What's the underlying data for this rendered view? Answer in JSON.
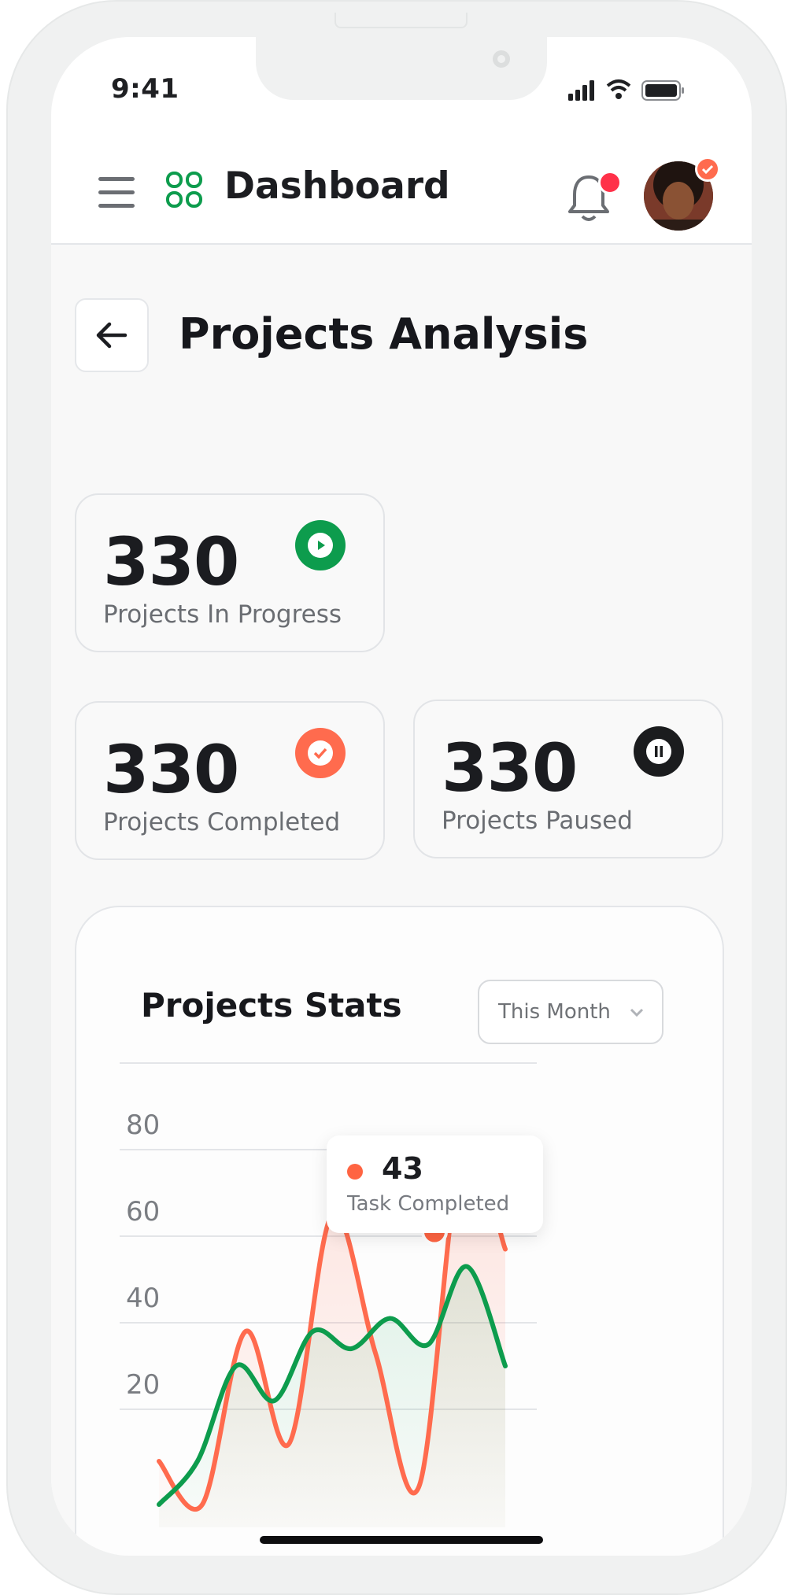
{
  "status_bar": {
    "time": "9:41"
  },
  "header": {
    "title": "Dashboard",
    "logo_icon": "apps-grid-icon",
    "menu_icon": "hamburger-icon",
    "notification_icon": "bell-icon"
  },
  "page": {
    "title": "Projects Analysis"
  },
  "stats": [
    {
      "value": "330",
      "label": "Projects In Progress",
      "icon": "play-icon",
      "color": "#0d9c4d"
    },
    {
      "value": "330",
      "label": "Projects Completed",
      "icon": "check-icon",
      "color": "#ff6b4e"
    },
    {
      "value": "330",
      "label": "Projects Paused",
      "icon": "pause-icon",
      "color": "#1b1c1e"
    }
  ],
  "projects_stats": {
    "title": "Projects Stats",
    "period": "This Month",
    "tooltip": {
      "value": "43",
      "label": "Task Completed"
    }
  },
  "chart_data": {
    "type": "line",
    "title": "",
    "xlabel": "",
    "ylabel": "",
    "ylim": [
      0,
      100
    ],
    "y_ticks": [
      "80",
      "60",
      "40",
      "20"
    ],
    "x": [
      0,
      1,
      2,
      3,
      4,
      5,
      6,
      7,
      8,
      9,
      10,
      11,
      12,
      13
    ],
    "series": [
      {
        "color": "#ff6b4e",
        "values": [
          8,
          -2,
          38,
          12,
          65,
          33,
          2,
          80,
          57
        ]
      },
      {
        "color": "#0d9c4d",
        "values": [
          -2,
          8,
          30,
          22,
          38,
          34,
          41,
          35,
          53,
          30
        ]
      }
    ],
    "grid": true,
    "area_fill": true,
    "highlight": {
      "series": 0,
      "value": 43
    }
  },
  "colors": {
    "accent_green": "#0d9c4d",
    "accent_orange": "#ff6b4e",
    "notification_red": "#ff3149"
  }
}
